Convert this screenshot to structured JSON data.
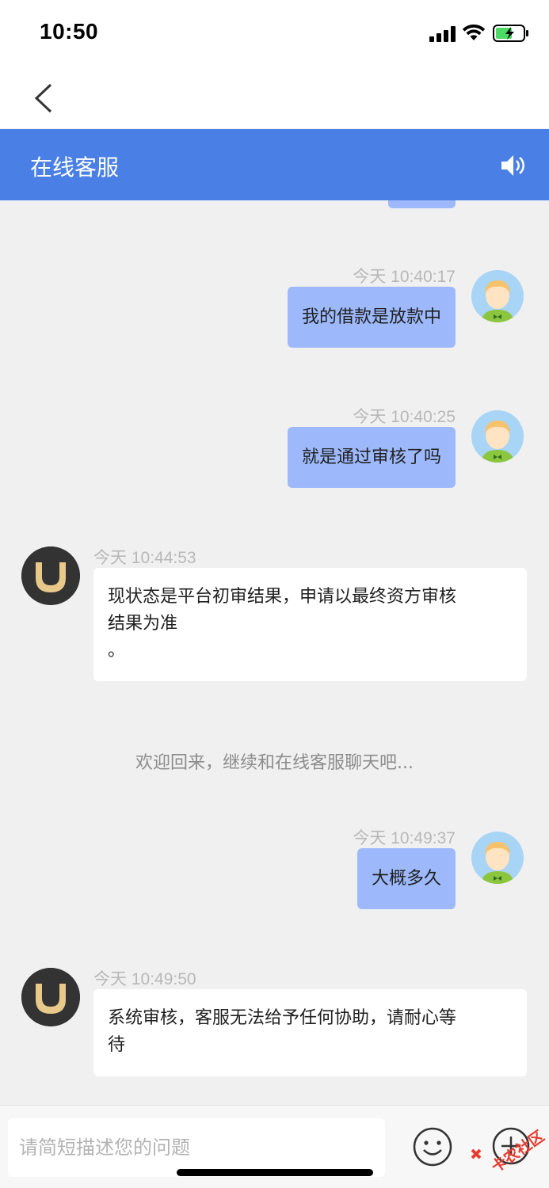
{
  "status_bar": {
    "time": "10:50"
  },
  "header": {
    "title": "在线客服",
    "speaker_icon": "speaker-icon"
  },
  "colors": {
    "header_bg": "#4a7fe6",
    "user_bubble": "#9db9fb",
    "agent_bubble": "#ffffff",
    "page_bg": "#f0f0f0"
  },
  "messages": [
    {
      "from": "user",
      "time": "今天 10:40:17",
      "text": "我的借款是放款中"
    },
    {
      "from": "user",
      "time": "今天 10:40:25",
      "text": "就是通过审核了吗"
    },
    {
      "from": "agent",
      "time": "今天 10:44:53",
      "lines": [
        "现状态是平台初审结果，申请以最终资方审核",
        "结果为准",
        "。"
      ]
    },
    {
      "from": "system",
      "text": "欢迎回来，继续和在线客服聊天吧..."
    },
    {
      "from": "user",
      "time": "今天 10:49:37",
      "text": "大概多久"
    },
    {
      "from": "agent",
      "time": "今天 10:49:50",
      "lines": [
        "系统审核，客服无法给予任何协助，请耐心等",
        "待"
      ]
    }
  ],
  "input": {
    "placeholder": "请简短描述您的问题"
  },
  "watermark": {
    "text": "卡农社区"
  }
}
